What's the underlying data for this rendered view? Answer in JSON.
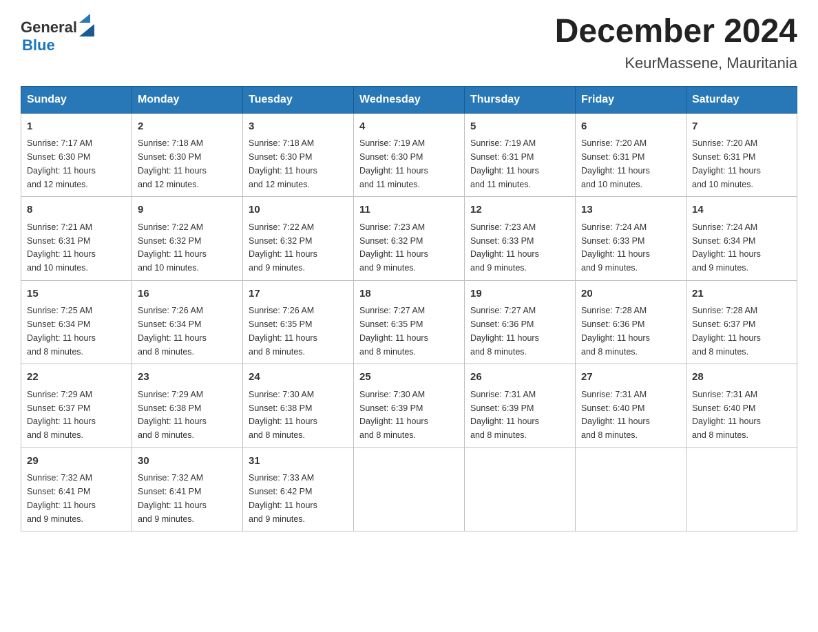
{
  "header": {
    "logo_general": "General",
    "logo_blue": "Blue",
    "month": "December 2024",
    "location": "KeurMassene, Mauritania"
  },
  "days_of_week": [
    "Sunday",
    "Monday",
    "Tuesday",
    "Wednesday",
    "Thursday",
    "Friday",
    "Saturday"
  ],
  "weeks": [
    [
      {
        "day": "1",
        "sunrise": "7:17 AM",
        "sunset": "6:30 PM",
        "daylight": "11 hours and 12 minutes."
      },
      {
        "day": "2",
        "sunrise": "7:18 AM",
        "sunset": "6:30 PM",
        "daylight": "11 hours and 12 minutes."
      },
      {
        "day": "3",
        "sunrise": "7:18 AM",
        "sunset": "6:30 PM",
        "daylight": "11 hours and 12 minutes."
      },
      {
        "day": "4",
        "sunrise": "7:19 AM",
        "sunset": "6:30 PM",
        "daylight": "11 hours and 11 minutes."
      },
      {
        "day": "5",
        "sunrise": "7:19 AM",
        "sunset": "6:31 PM",
        "daylight": "11 hours and 11 minutes."
      },
      {
        "day": "6",
        "sunrise": "7:20 AM",
        "sunset": "6:31 PM",
        "daylight": "11 hours and 10 minutes."
      },
      {
        "day": "7",
        "sunrise": "7:20 AM",
        "sunset": "6:31 PM",
        "daylight": "11 hours and 10 minutes."
      }
    ],
    [
      {
        "day": "8",
        "sunrise": "7:21 AM",
        "sunset": "6:31 PM",
        "daylight": "11 hours and 10 minutes."
      },
      {
        "day": "9",
        "sunrise": "7:22 AM",
        "sunset": "6:32 PM",
        "daylight": "11 hours and 10 minutes."
      },
      {
        "day": "10",
        "sunrise": "7:22 AM",
        "sunset": "6:32 PM",
        "daylight": "11 hours and 9 minutes."
      },
      {
        "day": "11",
        "sunrise": "7:23 AM",
        "sunset": "6:32 PM",
        "daylight": "11 hours and 9 minutes."
      },
      {
        "day": "12",
        "sunrise": "7:23 AM",
        "sunset": "6:33 PM",
        "daylight": "11 hours and 9 minutes."
      },
      {
        "day": "13",
        "sunrise": "7:24 AM",
        "sunset": "6:33 PM",
        "daylight": "11 hours and 9 minutes."
      },
      {
        "day": "14",
        "sunrise": "7:24 AM",
        "sunset": "6:34 PM",
        "daylight": "11 hours and 9 minutes."
      }
    ],
    [
      {
        "day": "15",
        "sunrise": "7:25 AM",
        "sunset": "6:34 PM",
        "daylight": "11 hours and 8 minutes."
      },
      {
        "day": "16",
        "sunrise": "7:26 AM",
        "sunset": "6:34 PM",
        "daylight": "11 hours and 8 minutes."
      },
      {
        "day": "17",
        "sunrise": "7:26 AM",
        "sunset": "6:35 PM",
        "daylight": "11 hours and 8 minutes."
      },
      {
        "day": "18",
        "sunrise": "7:27 AM",
        "sunset": "6:35 PM",
        "daylight": "11 hours and 8 minutes."
      },
      {
        "day": "19",
        "sunrise": "7:27 AM",
        "sunset": "6:36 PM",
        "daylight": "11 hours and 8 minutes."
      },
      {
        "day": "20",
        "sunrise": "7:28 AM",
        "sunset": "6:36 PM",
        "daylight": "11 hours and 8 minutes."
      },
      {
        "day": "21",
        "sunrise": "7:28 AM",
        "sunset": "6:37 PM",
        "daylight": "11 hours and 8 minutes."
      }
    ],
    [
      {
        "day": "22",
        "sunrise": "7:29 AM",
        "sunset": "6:37 PM",
        "daylight": "11 hours and 8 minutes."
      },
      {
        "day": "23",
        "sunrise": "7:29 AM",
        "sunset": "6:38 PM",
        "daylight": "11 hours and 8 minutes."
      },
      {
        "day": "24",
        "sunrise": "7:30 AM",
        "sunset": "6:38 PM",
        "daylight": "11 hours and 8 minutes."
      },
      {
        "day": "25",
        "sunrise": "7:30 AM",
        "sunset": "6:39 PM",
        "daylight": "11 hours and 8 minutes."
      },
      {
        "day": "26",
        "sunrise": "7:31 AM",
        "sunset": "6:39 PM",
        "daylight": "11 hours and 8 minutes."
      },
      {
        "day": "27",
        "sunrise": "7:31 AM",
        "sunset": "6:40 PM",
        "daylight": "11 hours and 8 minutes."
      },
      {
        "day": "28",
        "sunrise": "7:31 AM",
        "sunset": "6:40 PM",
        "daylight": "11 hours and 8 minutes."
      }
    ],
    [
      {
        "day": "29",
        "sunrise": "7:32 AM",
        "sunset": "6:41 PM",
        "daylight": "11 hours and 9 minutes."
      },
      {
        "day": "30",
        "sunrise": "7:32 AM",
        "sunset": "6:41 PM",
        "daylight": "11 hours and 9 minutes."
      },
      {
        "day": "31",
        "sunrise": "7:33 AM",
        "sunset": "6:42 PM",
        "daylight": "11 hours and 9 minutes."
      },
      null,
      null,
      null,
      null
    ]
  ],
  "labels": {
    "sunrise": "Sunrise:",
    "sunset": "Sunset:",
    "daylight": "Daylight:"
  }
}
